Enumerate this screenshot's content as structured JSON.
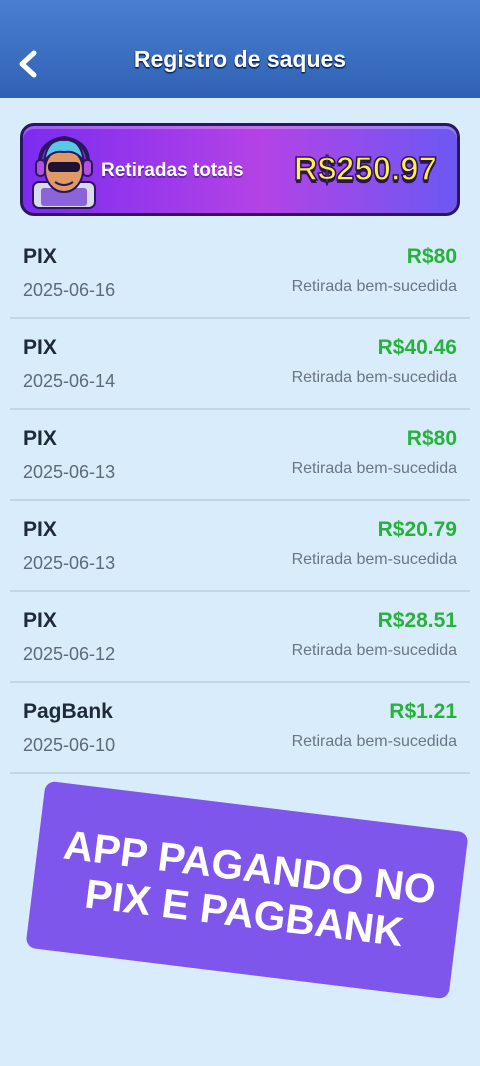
{
  "header": {
    "title": "Registro de saques",
    "back_icon": "chevron-left-icon"
  },
  "total": {
    "label": "Retiradas totais",
    "value": "R$250.97",
    "avatar_icon": "gamer-avatar-icon"
  },
  "withdrawals": [
    {
      "method": "PIX",
      "date": "2025-06-16",
      "amount": "R$80",
      "status": "Retirada bem-sucedida"
    },
    {
      "method": "PIX",
      "date": "2025-06-14",
      "amount": "R$40.46",
      "status": "Retirada bem-sucedida"
    },
    {
      "method": "PIX",
      "date": "2025-06-13",
      "amount": "R$80",
      "status": "Retirada bem-sucedida"
    },
    {
      "method": "PIX",
      "date": "2025-06-13",
      "amount": "R$20.79",
      "status": "Retirada bem-sucedida"
    },
    {
      "method": "PIX",
      "date": "2025-06-12",
      "amount": "R$28.51",
      "status": "Retirada bem-sucedida"
    },
    {
      "method": "PagBank",
      "date": "2025-06-10",
      "amount": "R$1.21",
      "status": "Retirada bem-sucedida"
    }
  ],
  "promo": {
    "lines": [
      "APP PAGANDO NO",
      "PIX E PAGBANK"
    ]
  },
  "colors": {
    "header": "#3a6ec2",
    "background": "#d9ecfb",
    "amount_green": "#27b23c",
    "total_yellow": "#fff04a",
    "promo_purple": "#7f56ec"
  }
}
